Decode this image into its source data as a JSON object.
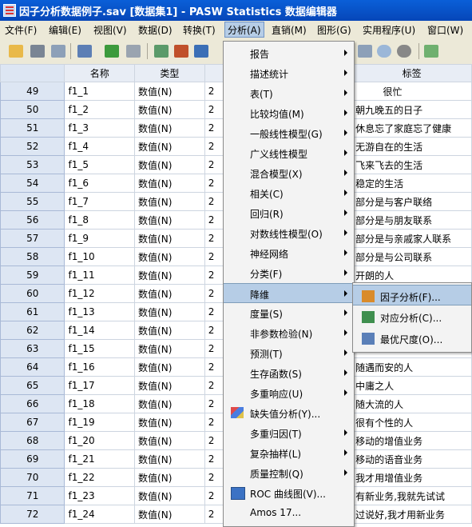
{
  "window": {
    "title": "因子分析数据例子.sav [数据集1] - PASW Statistics 数据编辑器"
  },
  "menubar": {
    "items": [
      "文件(F)",
      "编辑(E)",
      "视图(V)",
      "数据(D)",
      "转换(T)",
      "分析(A)",
      "直销(M)",
      "图形(G)",
      "实用程序(U)",
      "窗口(W)"
    ],
    "active_index": 5
  },
  "grid": {
    "headers": [
      "",
      "名称",
      "类型",
      "",
      "标签"
    ],
    "rows": [
      {
        "num": "49",
        "name": "f1_1",
        "type": "数值(N)",
        "width": "2",
        "label": "         很忙"
      },
      {
        "num": "50",
        "name": "f1_2",
        "type": "数值(N)",
        "width": "2",
        "label": "朝九晚五的日子"
      },
      {
        "num": "51",
        "name": "f1_3",
        "type": "数值(N)",
        "width": "2",
        "label": "休息忘了家庭忘了健康"
      },
      {
        "num": "52",
        "name": "f1_4",
        "type": "数值(N)",
        "width": "2",
        "label": "无游自在的生活"
      },
      {
        "num": "53",
        "name": "f1_5",
        "type": "数值(N)",
        "width": "2",
        "label": "飞来飞去的生活"
      },
      {
        "num": "54",
        "name": "f1_6",
        "type": "数值(N)",
        "width": "2",
        "label": "稳定的生活"
      },
      {
        "num": "55",
        "name": "f1_7",
        "type": "数值(N)",
        "width": "2",
        "label": "部分是与客户联络"
      },
      {
        "num": "56",
        "name": "f1_8",
        "type": "数值(N)",
        "width": "2",
        "label": "部分是与朋友联系"
      },
      {
        "num": "57",
        "name": "f1_9",
        "type": "数值(N)",
        "width": "2",
        "label": "部分是与亲戚家人联系"
      },
      {
        "num": "58",
        "name": "f1_10",
        "type": "数值(N)",
        "width": "2",
        "label": "部分是与公司联系"
      },
      {
        "num": "59",
        "name": "f1_11",
        "type": "数值(N)",
        "width": "2",
        "label": "开朗的人"
      },
      {
        "num": "60",
        "name": "f1_12",
        "type": "数值(N)",
        "width": "2",
        "label": ""
      },
      {
        "num": "61",
        "name": "f1_13",
        "type": "数值(N)",
        "width": "2",
        "label": ""
      },
      {
        "num": "62",
        "name": "f1_14",
        "type": "数值(N)",
        "width": "2",
        "label": ""
      },
      {
        "num": "63",
        "name": "f1_15",
        "type": "数值(N)",
        "width": "2",
        "label": ""
      },
      {
        "num": "64",
        "name": "f1_16",
        "type": "数值(N)",
        "width": "2",
        "label": "随遇而安的人"
      },
      {
        "num": "65",
        "name": "f1_17",
        "type": "数值(N)",
        "width": "2",
        "label": "中庸之人"
      },
      {
        "num": "66",
        "name": "f1_18",
        "type": "数值(N)",
        "width": "2",
        "label": "随大流的人"
      },
      {
        "num": "67",
        "name": "f1_19",
        "type": "数值(N)",
        "width": "2",
        "label": "很有个性的人"
      },
      {
        "num": "68",
        "name": "f1_20",
        "type": "数值(N)",
        "width": "2",
        "label": "移动的增值业务"
      },
      {
        "num": "69",
        "name": "f1_21",
        "type": "数值(N)",
        "width": "2",
        "label": "移动的语音业务"
      },
      {
        "num": "70",
        "name": "f1_22",
        "type": "数值(N)",
        "width": "2",
        "label": "我才用增值业务"
      },
      {
        "num": "71",
        "name": "f1_23",
        "type": "数值(N)",
        "width": "2",
        "label": "有新业务,我就先试试"
      },
      {
        "num": "72",
        "name": "f1_24",
        "type": "数值(N)",
        "width": "2",
        "label": "过说好,我才用新业务"
      }
    ]
  },
  "analyze_menu": {
    "items": [
      {
        "label": "报告",
        "arrow": true
      },
      {
        "label": "描述统计",
        "arrow": true
      },
      {
        "label": "表(T)",
        "arrow": true
      },
      {
        "label": "比较均值(M)",
        "arrow": true
      },
      {
        "label": "一般线性模型(G)",
        "arrow": true
      },
      {
        "label": "广义线性模型",
        "arrow": true
      },
      {
        "label": "混合模型(X)",
        "arrow": true
      },
      {
        "label": "相关(C)",
        "arrow": true
      },
      {
        "label": "回归(R)",
        "arrow": true
      },
      {
        "label": "对数线性模型(O)",
        "arrow": true
      },
      {
        "label": "神经网络",
        "arrow": true
      },
      {
        "label": "分类(F)",
        "arrow": true
      },
      {
        "label": "降维",
        "arrow": true,
        "highlight": true
      },
      {
        "label": "度量(S)",
        "arrow": true
      },
      {
        "label": "非参数检验(N)",
        "arrow": true
      },
      {
        "label": "预测(T)",
        "arrow": true
      },
      {
        "label": "生存函数(S)",
        "arrow": true
      },
      {
        "label": "多重响应(U)",
        "arrow": true
      },
      {
        "label": "缺失值分析(Y)...",
        "arrow": false,
        "icon": "missing-values-icon"
      },
      {
        "label": "多重归因(T)",
        "arrow": true
      },
      {
        "label": "复杂抽样(L)",
        "arrow": true
      },
      {
        "label": "质量控制(Q)",
        "arrow": true
      },
      {
        "label": "ROC 曲线图(V)...",
        "arrow": false,
        "icon": "roc-curve-icon"
      },
      {
        "label": "Amos 17...",
        "arrow": false
      }
    ]
  },
  "dimension_submenu": {
    "items": [
      {
        "label": "因子分析(F)...",
        "icon": "factor-analysis-icon",
        "highlight": true
      },
      {
        "label": "对应分析(C)...",
        "icon": "correspondence-analysis-icon"
      },
      {
        "label": "最优尺度(O)...",
        "icon": "optimal-scaling-icon"
      }
    ]
  },
  "colors": {
    "title_bar": "#0a5fd8",
    "highlight": "#b6cde6",
    "row_header": "#dde6f3"
  }
}
